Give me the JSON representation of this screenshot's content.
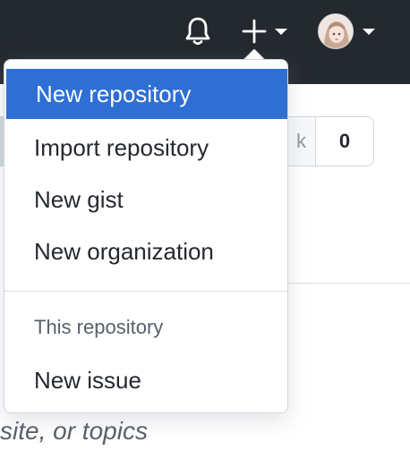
{
  "header": {
    "icons": [
      "bell-icon",
      "plus-icon",
      "caret-down-icon",
      "avatar"
    ],
    "background": "#24292f"
  },
  "page": {
    "counter_partial": "k",
    "counter_value": "0",
    "topics_partial": "site, or topics"
  },
  "dropdown": {
    "items": [
      {
        "label": "New repository",
        "active": true
      },
      {
        "label": "Import repository",
        "active": false
      },
      {
        "label": "New gist",
        "active": false
      },
      {
        "label": "New organization",
        "active": false
      }
    ],
    "section_label": "This repository",
    "section_items": [
      {
        "label": "New issue"
      }
    ],
    "active_color": "#2f6fd3"
  }
}
